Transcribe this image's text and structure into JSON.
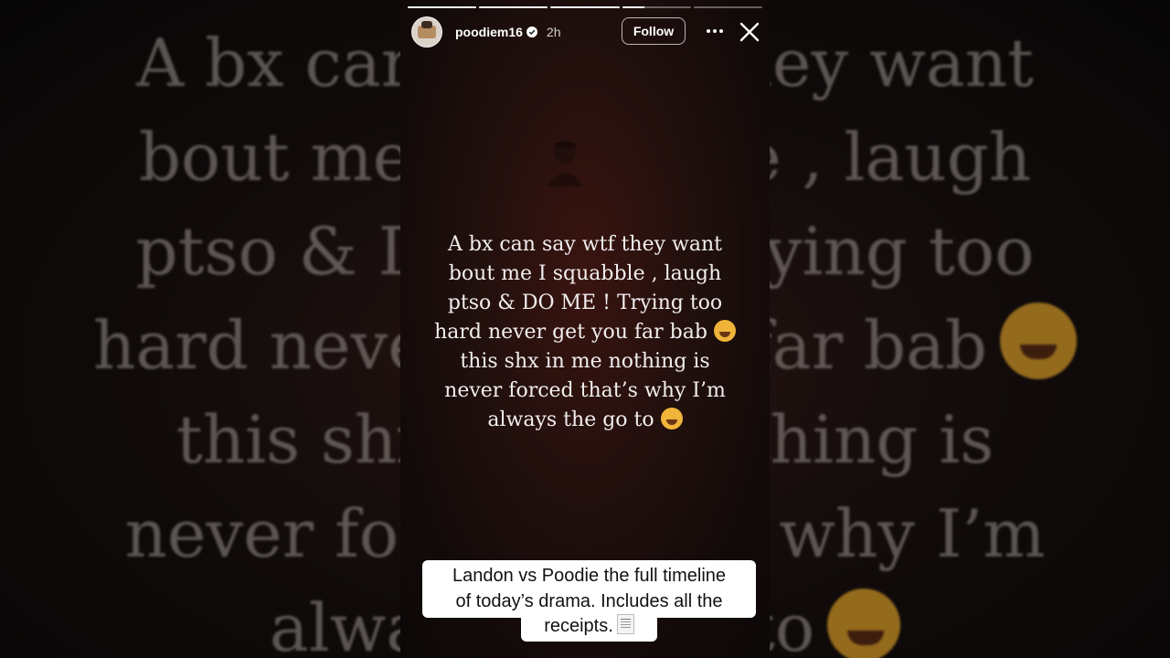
{
  "story": {
    "username": "poodiem16",
    "verified_icon": "verified-badge-icon",
    "time_ago": "2h",
    "follow_label": "Follow",
    "more_icon": "more-horizontal-icon",
    "close_icon": "close-icon",
    "progress_fills": [
      1,
      1,
      1,
      0.32,
      0
    ],
    "caption_lines": [
      "A bx can say wtf they want",
      "bout me I squabble , laugh",
      "ptso & DO ME ! Trying too",
      "hard never get you far bab",
      "this shx in me nothing is",
      "never forced that’s why I’m",
      "always the go to"
    ],
    "caption_emojis": [
      "laughing-face-emoji",
      "winking-face-emoji"
    ]
  },
  "background_blur": {
    "lines": [
      "A bx can say wtf they want",
      "bout me I squabble , laugh",
      "ptso & DO ME ! Trying too",
      "hard never get you far bab",
      "this shx in me nothing is",
      "never forced that’s why I’m",
      "always the go to"
    ]
  },
  "overlay": {
    "lines": [
      "Landon vs Poodie the full timeline",
      "of today’s drama. Includes all the",
      "receipts."
    ],
    "icon": "receipt-icon"
  },
  "colors": {
    "panel_bg": "#22100d",
    "text": "#f1eeee",
    "overlay_bg": "#ffffff"
  }
}
